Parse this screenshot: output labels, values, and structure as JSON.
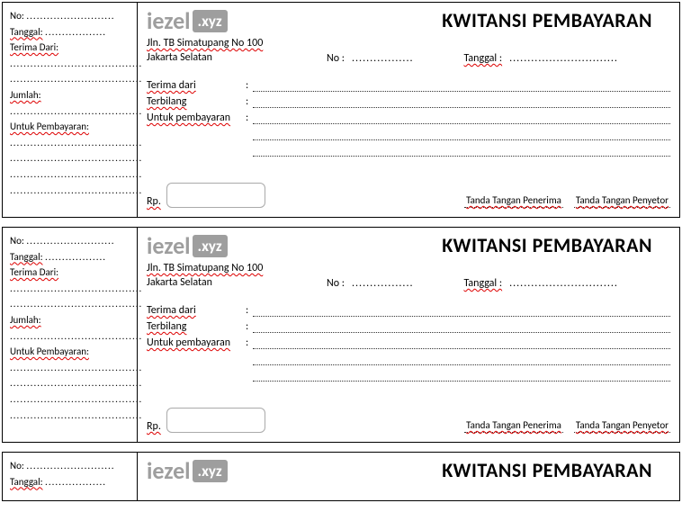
{
  "title": "KWITANSI PEMBAYARAN",
  "logo": {
    "text": "iezel",
    "badge": ".xyz"
  },
  "address": {
    "line1": "Jln. TB Simatupang No 100",
    "line2": "Jakarta Selatan"
  },
  "stub": {
    "no": "No:",
    "tanggal": "Tanggal:",
    "terima_dari": "Terima Dari:",
    "jumlah": "Jumlah:",
    "untuk": "Untuk Pembayaran:"
  },
  "main": {
    "no": "No :",
    "tanggal": "Tanggal :",
    "terima_dari": "Terima dari",
    "terbilang": "Terbilang",
    "untuk": "Untuk pembayaran",
    "rp": "Rp."
  },
  "signatures": {
    "penerima": "Tanda Tangan Penerima",
    "penyetor": "Tanda Tangan Penyetor"
  }
}
